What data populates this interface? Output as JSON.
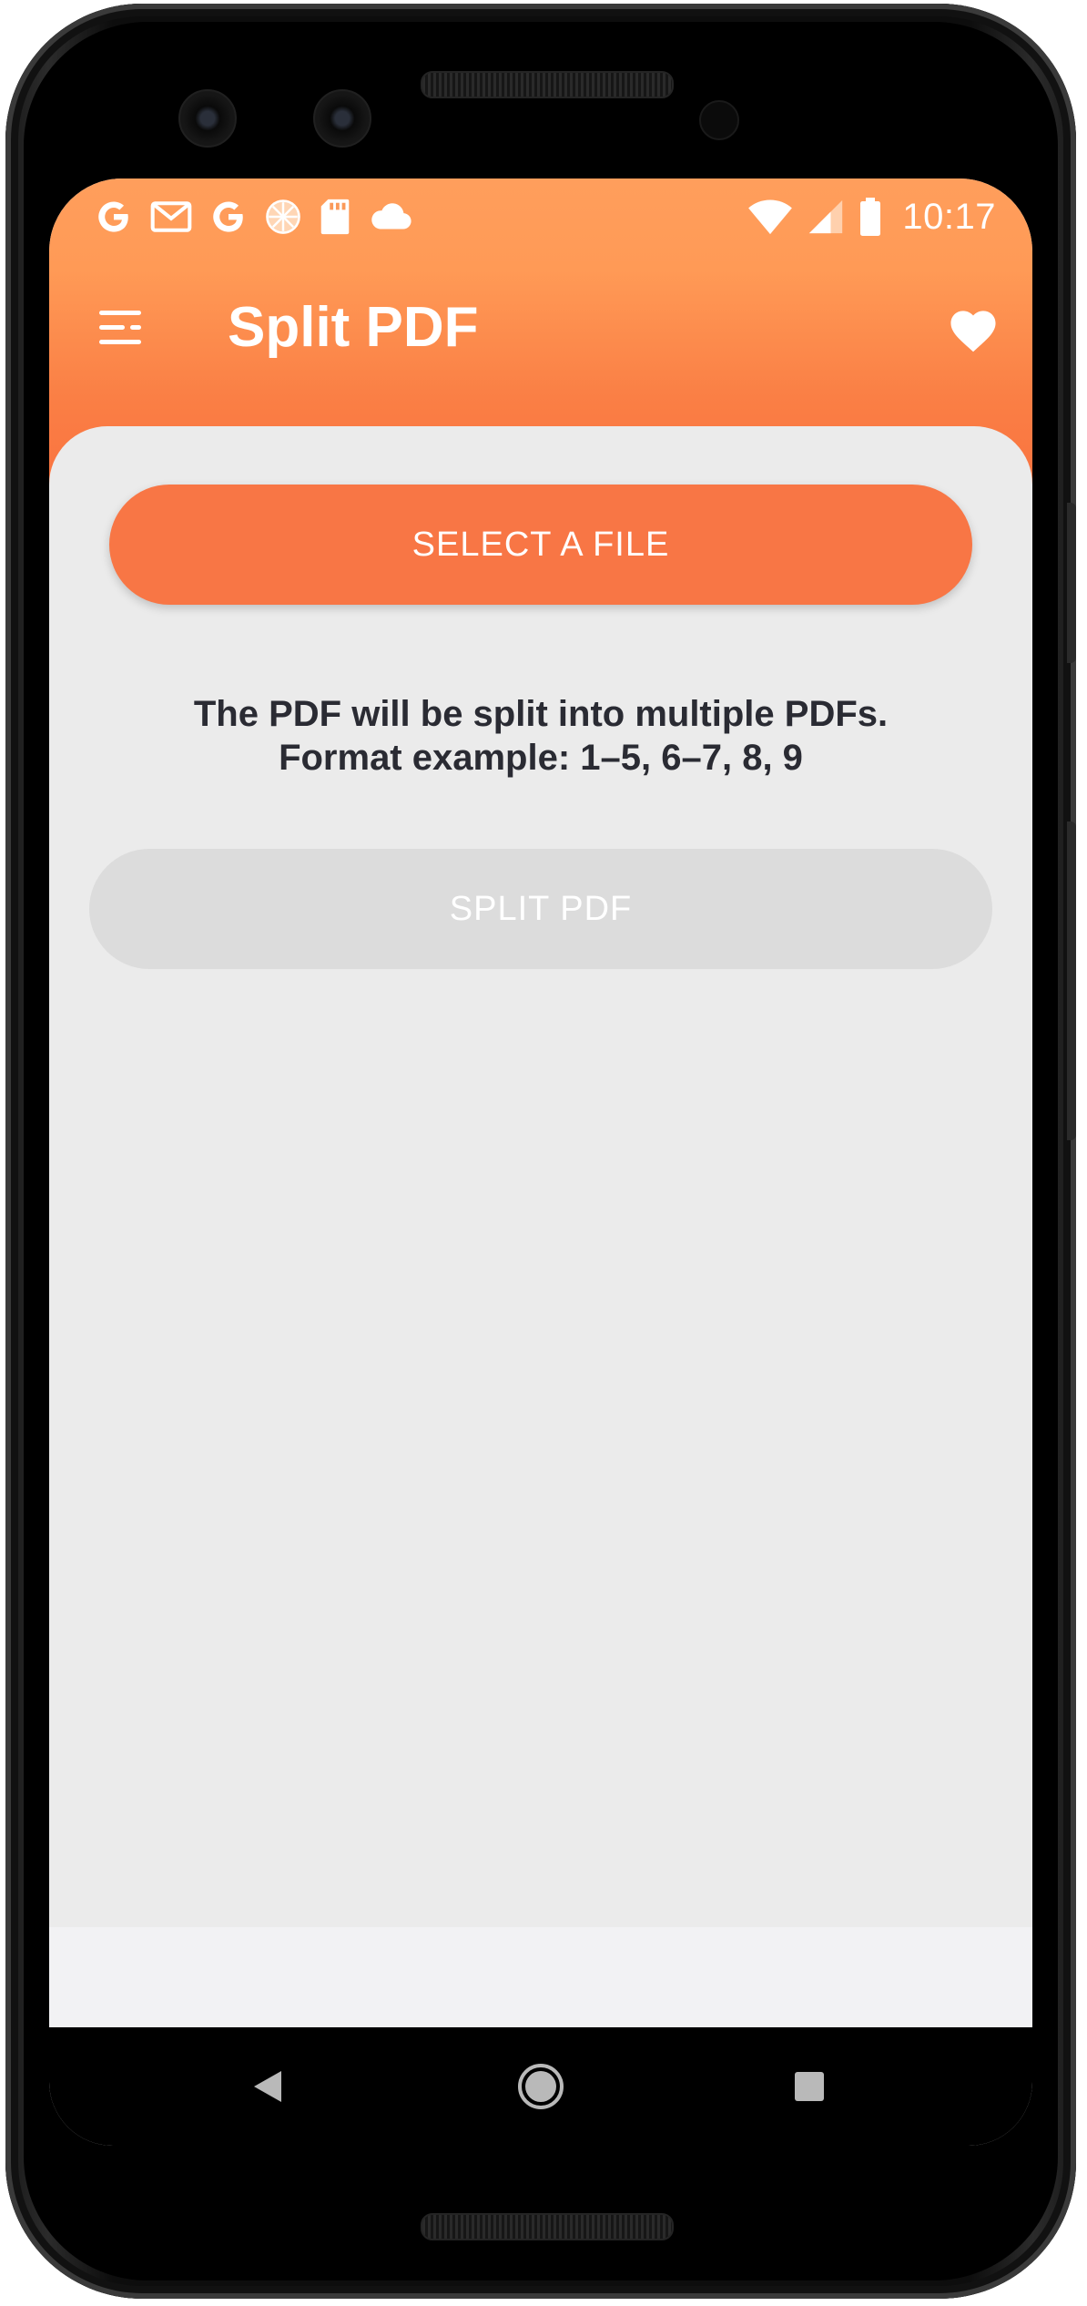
{
  "status_bar": {
    "time": "10:17",
    "notification_icons": [
      "google-g-icon",
      "gmail-icon",
      "google-g-icon",
      "sync-spinner-icon",
      "sd-card-icon",
      "cloud-icon"
    ],
    "system_icons": [
      "wifi-icon",
      "cellular-signal-icon",
      "battery-icon"
    ]
  },
  "app_bar": {
    "title": "Split PDF",
    "menu_icon": "hamburger-menu-icon",
    "favorite_icon": "heart-icon"
  },
  "main": {
    "select_button_label": "SELECT A FILE",
    "info_line_1": "The PDF will be split into multiple PDFs.",
    "info_line_2": "Format example: 1–5, 6–7, 8, 9",
    "split_button_label": "SPLIT PDF"
  },
  "navigation": {
    "back_icon": "back-triangle-icon",
    "home_icon": "home-circle-icon",
    "recents_icon": "recents-square-icon"
  },
  "colors": {
    "accent": "#f87645",
    "header_gradient_top": "#ff9e5c",
    "header_gradient_bottom": "#f97340",
    "disabled_button": "#dcdcdc",
    "background": "#ebebeb",
    "text_dark": "#2a2b33"
  }
}
